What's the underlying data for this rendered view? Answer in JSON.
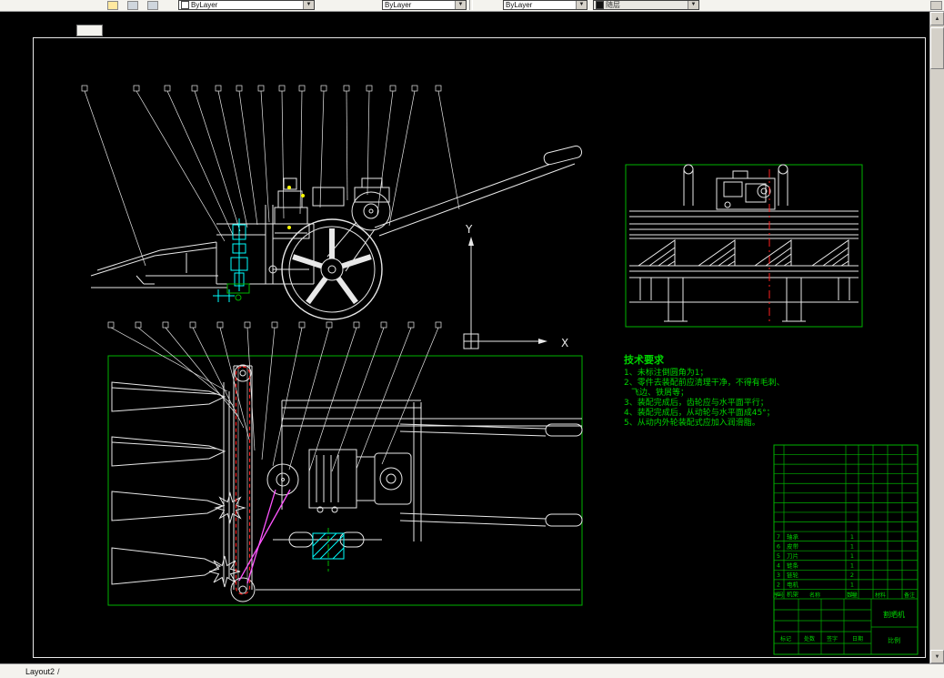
{
  "toolbar": {
    "color_control": "ByLayer",
    "linetype_control": "ByLayer",
    "lineweight_control": "ByLayer",
    "plot_style_control": "随层"
  },
  "statusbar": {
    "layout_tab": "Layout2",
    "tab_separator": "/"
  },
  "ucs": {
    "x": "X",
    "y": "Y"
  },
  "tech_requirements": {
    "title": "技术要求",
    "lines": [
      "1、未标注倒圆角为1；",
      "2、零件去装配前应清理干净，不得有毛刺、",
      "飞边、铁屑等；",
      "3、装配完成后，齿轮应与水平面平行；",
      "4、装配完成后，从动轮与水平面成45°；",
      "5、从动内外轮装配式应加入润滑脂。"
    ]
  },
  "title_block": {
    "header": [
      "序号",
      "名称",
      "数量",
      "材料",
      "备注"
    ],
    "parts": [
      {
        "no": "7",
        "name": "轴承",
        "qty": "1"
      },
      {
        "no": "6",
        "name": "皮带",
        "qty": "1"
      },
      {
        "no": "5",
        "name": "刀片",
        "qty": "1"
      },
      {
        "no": "4",
        "name": "链条",
        "qty": "1"
      },
      {
        "no": "3",
        "name": "链轮",
        "qty": "2"
      },
      {
        "no": "2",
        "name": "电机",
        "qty": "1"
      },
      {
        "no": "1",
        "name": "机架",
        "qty": "1"
      }
    ],
    "sign_labels": [
      "标记",
      "处数",
      "签字",
      "日期"
    ],
    "drawing_name": "割晒机",
    "scale_label": "比例"
  },
  "colors": {
    "line_green": "#00b400",
    "text_green": "#00d400",
    "cyan": "#00ffff",
    "magenta": "#ff55ff",
    "red": "#ff2020",
    "white": "#e8e8e8",
    "yellow": "#ffff00"
  }
}
